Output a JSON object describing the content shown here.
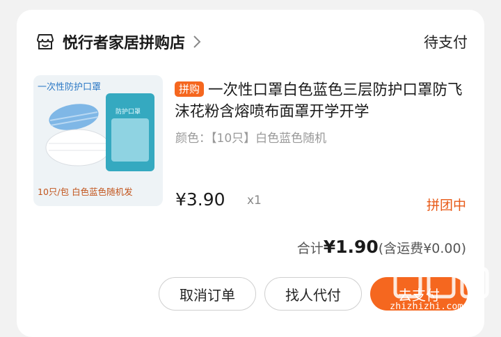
{
  "store": {
    "name": "悦行者家居拼购店",
    "status": "待支付"
  },
  "product": {
    "thumb_top_text": "一次性防护口罩",
    "thumb_bottom_text": "10只/包  白色蓝色随机发",
    "tag": "拼购",
    "title": "一次性口罩白色蓝色三层防护口罩防飞沫花粉含熔喷布面罩开学开学",
    "spec": "颜色：【10只】白色蓝色随机",
    "price": "¥3.90",
    "qty": "x1",
    "group_status": "拼团中"
  },
  "summary": {
    "label": "合计",
    "amount": "¥1.90",
    "shipping": "(含运费¥0.00)"
  },
  "actions": {
    "cancel": "取消订单",
    "peer_pay": "找人代付",
    "pay": "去支付"
  },
  "watermark": {
    "text": "zhizhizhi.com"
  },
  "colors": {
    "accent": "#f5671f",
    "accent_text": "#e85a17"
  }
}
